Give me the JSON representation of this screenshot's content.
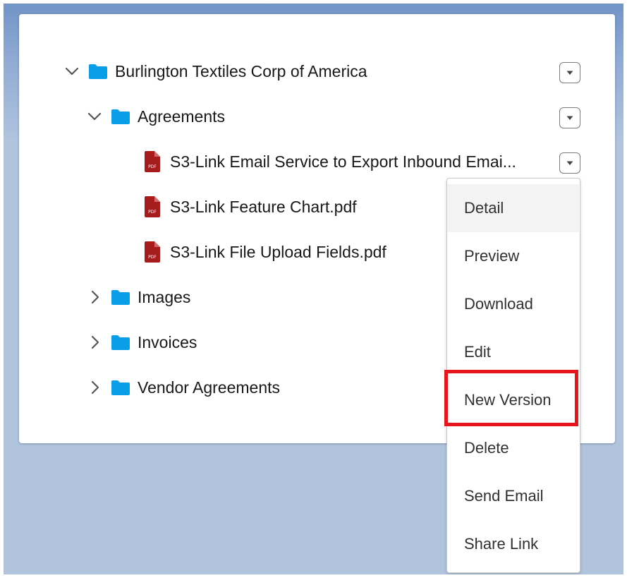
{
  "tree": {
    "root": {
      "label": "Burlington Textiles Corp of America",
      "expanded": true
    },
    "agreements": {
      "label": "Agreements",
      "expanded": true
    },
    "files": [
      {
        "label": "S3-Link Email Service to Export Inbound Emai..."
      },
      {
        "label": "S3-Link Feature Chart.pdf"
      },
      {
        "label": "S3-Link File Upload Fields.pdf"
      }
    ],
    "folders": [
      {
        "label": "Images",
        "expanded": false
      },
      {
        "label": "Invoices",
        "expanded": false
      },
      {
        "label": "Vendor Agreements",
        "expanded": false
      }
    ]
  },
  "menu": {
    "items": [
      {
        "label": "Detail"
      },
      {
        "label": "Preview"
      },
      {
        "label": "Download"
      },
      {
        "label": "Edit"
      },
      {
        "label": "New Version"
      },
      {
        "label": "Delete"
      },
      {
        "label": "Send Email"
      },
      {
        "label": "Share Link"
      }
    ],
    "hovered": "Detail",
    "highlighted": "New Version"
  },
  "colors": {
    "folder": "#0b9ee8",
    "pdf": "#a61b1b",
    "highlight": "#e8141c",
    "background": "#b0c4de"
  },
  "icons": {
    "expanded": "chevron-down-icon",
    "collapsed": "chevron-right-icon",
    "folder": "folder-icon",
    "pdf": "pdf-file-icon",
    "dropdown": "caret-down-icon"
  }
}
